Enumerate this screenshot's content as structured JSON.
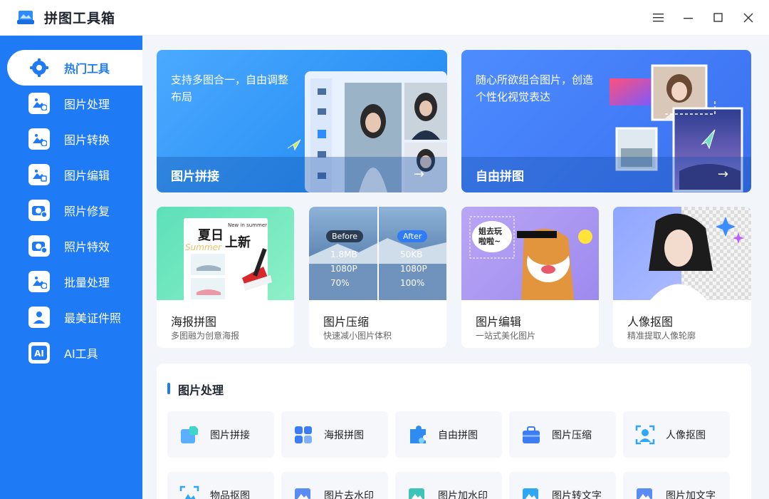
{
  "app": {
    "title": "拼图工具箱"
  },
  "sidebar": {
    "items": [
      {
        "label": "热门工具",
        "icon": "gear-icon"
      },
      {
        "label": "图片处理",
        "icon": "image-clock-icon"
      },
      {
        "label": "图片转换",
        "icon": "image-convert-icon"
      },
      {
        "label": "图片编辑",
        "icon": "image-edit-icon"
      },
      {
        "label": "照片修复",
        "icon": "camera-plus-icon"
      },
      {
        "label": "照片特效",
        "icon": "camera-magic-icon"
      },
      {
        "label": "批量处理",
        "icon": "image-batch-icon"
      },
      {
        "label": "最美证件照",
        "icon": "id-photo-icon"
      },
      {
        "label": "AI工具",
        "icon": "ai-icon"
      }
    ]
  },
  "banners": [
    {
      "title": "图片拼接",
      "desc": "支持多图合一，自由调整布局",
      "arrow": "→"
    },
    {
      "title": "自由拼图",
      "desc": "随心所欲组合图片，创造个性化视觉表达",
      "arrow": "→"
    }
  ],
  "cards": [
    {
      "title": "海报拼图",
      "sub": "多图融为创意海报",
      "poster_text": "夏日",
      "poster_text2": "上新",
      "poster_small": "New in summer",
      "poster_script": "Summer"
    },
    {
      "title": "图片压缩",
      "sub": "快速减小图片体积",
      "before": {
        "badge": "Before",
        "size": "1.8MB",
        "res": "1080P",
        "quality": "70%"
      },
      "after": {
        "badge": "After",
        "size": "50KB",
        "res": "1080P",
        "quality": "100%"
      }
    },
    {
      "title": "图片编辑",
      "sub": "一站式美化图片",
      "sticker": "姐去玩\n啦啦~"
    },
    {
      "title": "人像抠图",
      "sub": "精准提取人像轮廓"
    }
  ],
  "section": {
    "title": "图片处理",
    "row1": [
      {
        "label": "图片拼接",
        "icon": "puzzle-icon"
      },
      {
        "label": "海报拼图",
        "icon": "poster-grid-icon"
      },
      {
        "label": "自由拼图",
        "icon": "puzzle-piece-icon"
      },
      {
        "label": "图片压缩",
        "icon": "toolbox-icon"
      },
      {
        "label": "人像抠图",
        "icon": "portrait-cutout-icon"
      }
    ],
    "row2": [
      {
        "label": "物品抠图",
        "icon": "object-cutout-icon"
      },
      {
        "label": "图片去水印",
        "icon": "remove-watermark-icon"
      },
      {
        "label": "图片加水印",
        "icon": "add-watermark-icon"
      },
      {
        "label": "图片转文字",
        "icon": "image-to-text-icon"
      },
      {
        "label": "图片加文字",
        "icon": "add-text-icon"
      }
    ]
  },
  "colors": {
    "primary": "#1f7af5",
    "sidebar": "#1f7af5",
    "background": "#f2f5fa"
  }
}
